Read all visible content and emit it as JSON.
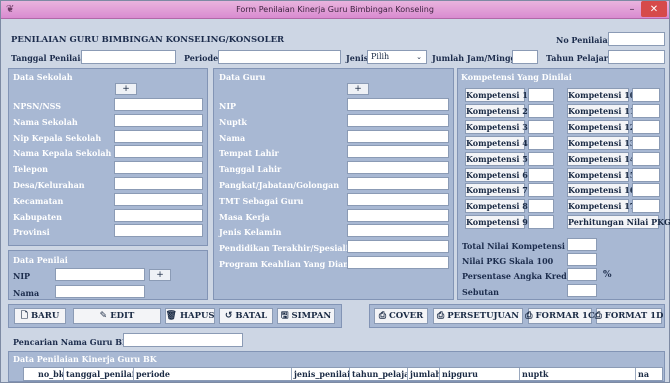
{
  "window": {
    "title": "Form Penilaian Kinerja Guru Bimbingan Konseling",
    "minimize": "–",
    "close": "✕"
  },
  "header": {
    "heading": "PENILAIAN GURU BIMBINGAN KONSELING/KONSOLER",
    "no_penilaian_label": "No Penilaian",
    "tanggal_label": "Tanggal Penilaian",
    "periode_label": "Periode",
    "jenis_label": "Jenis",
    "jenis_value": "Pilih",
    "jumlah_jam_label": "Jumlah Jam/Minggu",
    "tahun_label": "Tahun Pelajaran"
  },
  "sekolah": {
    "title": "Data Sekolah",
    "add": "+",
    "fields": [
      "NPSN/NSS",
      "Nama Sekolah",
      "Nip Kepala Sekolah",
      "Nama Kepala Sekolah",
      "Telepon",
      "Desa/Kelurahan",
      "Kecamatan",
      "Kabupaten",
      "Provinsi"
    ]
  },
  "penilai": {
    "title": "Data Penilai",
    "nip_label": "NIP",
    "nama_label": "Nama",
    "add": "+"
  },
  "guru": {
    "title": "Data Guru",
    "add": "+",
    "fields": [
      "NIP",
      "Nuptk",
      "Nama",
      "Tempat Lahir",
      "Tanggal Lahir",
      "Pangkat/Jabatan/Golongan",
      "TMT Sebagai Guru",
      "Masa Kerja",
      "Jenis Kelamin",
      "Pendidikan Terakhir/Spesialisas",
      "Program Keahlian Yang Diampu"
    ]
  },
  "kompetensi": {
    "title": "Kompetensi Yang Dinilai",
    "left": [
      "Kompetensi 1",
      "Kompetensi 2",
      "Kompetensi 3",
      "Kompetensi 4",
      "Kompetensi 5",
      "Kompetensi 6",
      "Kompetensi 7",
      "Kompetensi 8",
      "Kompetensi 9"
    ],
    "right": [
      "Kompetensi 10",
      "Kompetensi 11",
      "Kompetensi 12",
      "Kompetensi 13",
      "Kompetensi 14",
      "Kompetensi 15",
      "Kompetensi 16",
      "Kompetensi 17"
    ],
    "perhitungan": "Perhitungan Nilai PKG",
    "total_label": "Total Nilai Kompetensi",
    "skala_label": "Nilai PKG Skala 100",
    "persentase_label": "Persentase Angka Kredit",
    "percent_sign": "%",
    "sebutan_label": "Sebutan"
  },
  "actions": {
    "baru": "BARU",
    "edit": "EDIT",
    "hapus": "HAPUS",
    "batal": "BATAL",
    "simpan": "SIMPAN",
    "cover": "COVER",
    "persetujuan": "PERSETUJUAN",
    "formar1c": "FORMAR 1C",
    "format1d": "FORMAT 1D"
  },
  "search": {
    "label": "Pencarian Nama Guru BK"
  },
  "table": {
    "title": "Data Penilaian Kinerja Guru BK",
    "columns": [
      "no_bk",
      "tanggal_penilaian",
      "periode",
      "jenis_penilaian",
      "tahun_pelajaran",
      "jumlah_jam",
      "nipguru",
      "nuptk",
      "na"
    ]
  }
}
